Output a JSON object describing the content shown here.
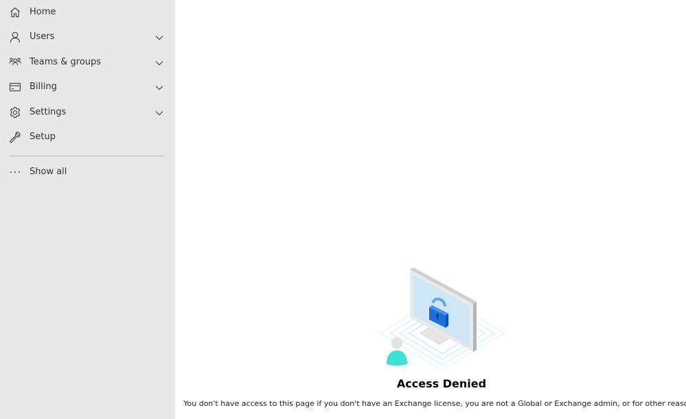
{
  "sidebar": {
    "items": [
      {
        "label": "Home",
        "icon": "home-icon",
        "expandable": false
      },
      {
        "label": "Users",
        "icon": "user-icon",
        "expandable": true
      },
      {
        "label": "Teams & groups",
        "icon": "people-icon",
        "expandable": true
      },
      {
        "label": "Billing",
        "icon": "credit-card-icon",
        "expandable": true
      },
      {
        "label": "Settings",
        "icon": "gear-icon",
        "expandable": true
      },
      {
        "label": "Setup",
        "icon": "wrench-icon",
        "expandable": false
      }
    ],
    "show_all": {
      "label": "Show all",
      "icon": "more-icon"
    }
  },
  "main": {
    "title": "Access Denied",
    "message": "You don't have access to this page if you don't have an Exchange license, you are not a Global or Exchange admin, or for other reasons."
  },
  "colors": {
    "sidebar_bg": "#e8e8e8",
    "accent_lock": "#1a6fd8",
    "person_accent": "#3fe0d8"
  }
}
